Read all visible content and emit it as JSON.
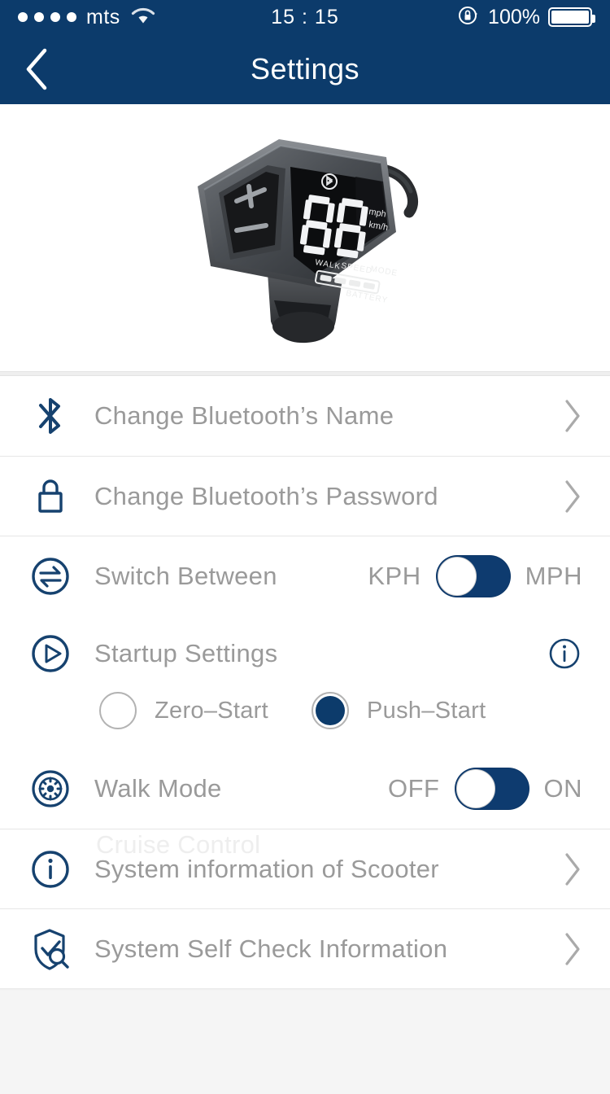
{
  "status_bar": {
    "signal_dots": 4,
    "carrier": "mts",
    "wifi_icon": "wifi-icon",
    "time": "15 : 15",
    "rotation_lock_icon": "rotation-lock-icon",
    "battery_percent": "100%",
    "battery_icon": "battery-full-icon"
  },
  "nav": {
    "back_icon": "chevron-left-icon",
    "title": "Settings"
  },
  "hero": {
    "device_name": "scooter-display-controller",
    "display_value": "88",
    "unit_top": "mph",
    "unit_bottom": "km/h",
    "mode_labels": [
      "WALK",
      "SPEED",
      "MODE"
    ],
    "battery_label": "BATTERY",
    "plus_label": "+",
    "minus_label": "−"
  },
  "rows": {
    "bluetooth_name": {
      "icon": "bluetooth-icon",
      "label": "Change Bluetooth’s Name",
      "chevron": "chevron-right-icon"
    },
    "bluetooth_password": {
      "icon": "lock-icon",
      "label": "Change Bluetooth’s Password",
      "chevron": "chevron-right-icon"
    },
    "switch_between": {
      "icon": "swap-arrows-icon",
      "label": "Switch Between",
      "left_option": "KPH",
      "right_option": "MPH",
      "toggle_state": "left"
    },
    "startup_settings": {
      "icon": "play-circle-icon",
      "label": "Startup Settings",
      "info_icon": "info-circle-icon",
      "options": [
        {
          "label": "Zero–Start",
          "selected": false
        },
        {
          "label": "Push–Start",
          "selected": true
        }
      ]
    },
    "walk_mode": {
      "icon": "walk-mode-icon",
      "label": "Walk Mode",
      "left_option": "OFF",
      "right_option": "ON",
      "toggle_state": "left"
    },
    "cruise_control_ghost": {
      "label": "Cruise Control"
    },
    "system_information": {
      "icon": "info-circle-icon",
      "label": "System information of Scooter",
      "chevron": "chevron-right-icon"
    },
    "self_check": {
      "icon": "shield-check-search-icon",
      "label": "System Self Check Information",
      "chevron": "chevron-right-icon"
    }
  },
  "colors": {
    "navy": "#0c3b6b",
    "toggle_track": "#0e3b6f",
    "label_gray": "#9a9a9a",
    "page_bg": "#f5f5f5",
    "card_bg": "#ffffff"
  }
}
